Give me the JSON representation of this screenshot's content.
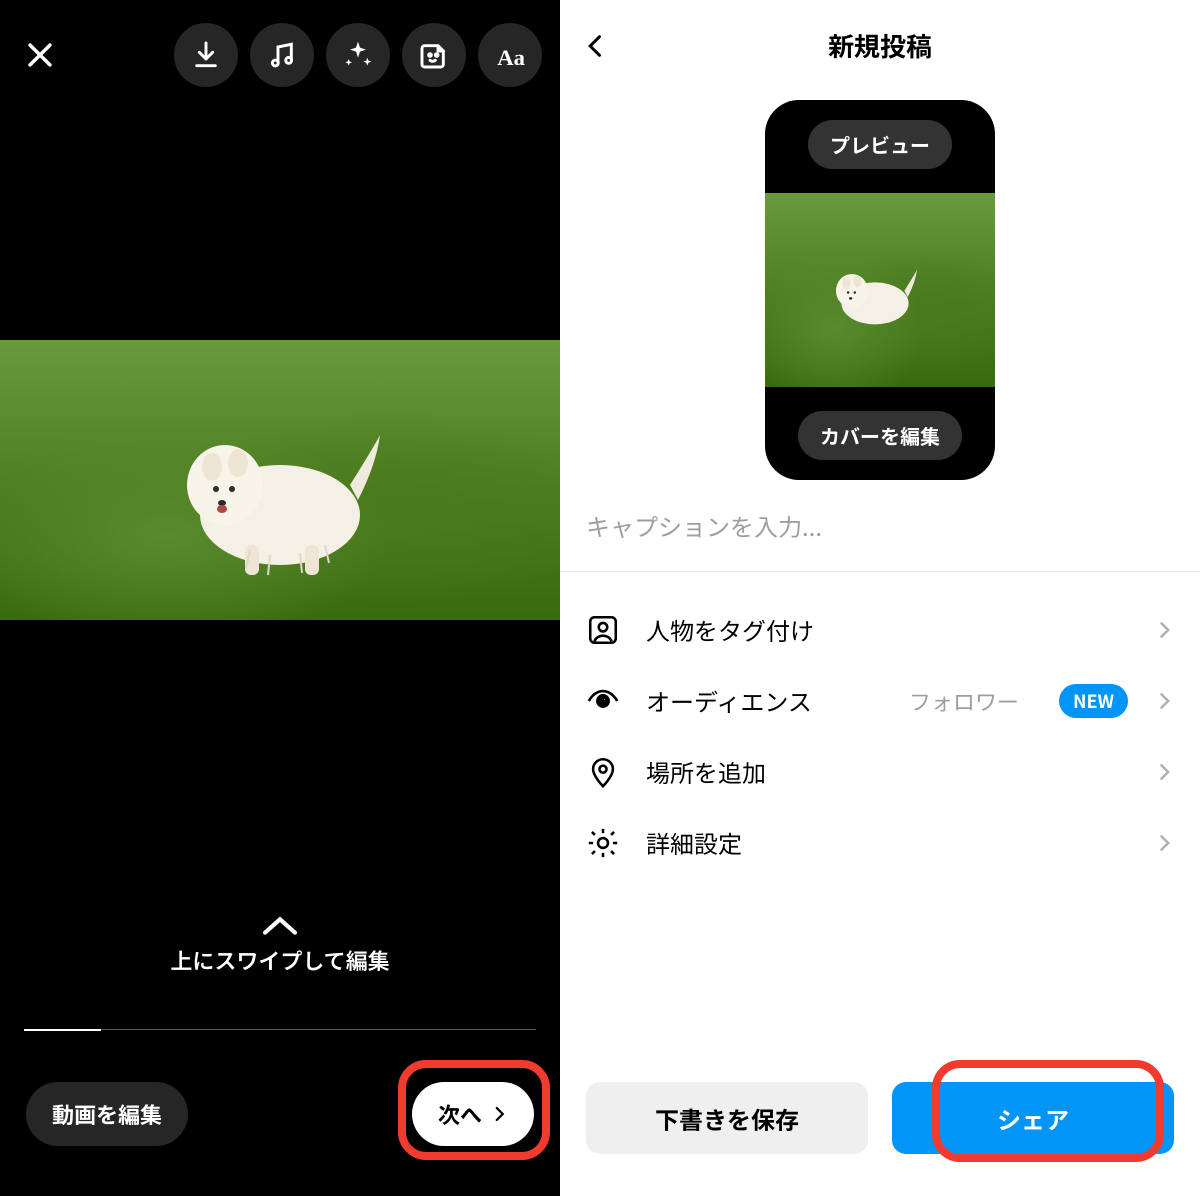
{
  "left": {
    "swipe_hint": "上にスワイプして編集",
    "edit_video_label": "動画を編集",
    "next_label": "次へ"
  },
  "right": {
    "title": "新規投稿",
    "preview_label": "プレビュー",
    "edit_cover_label": "カバーを編集",
    "caption_placeholder": "キャプションを入力...",
    "menu": {
      "tag_people": "人物をタグ付け",
      "audience": "オーディエンス",
      "audience_value": "フォロワー",
      "audience_badge": "NEW",
      "add_location": "場所を追加",
      "advanced": "詳細設定"
    },
    "save_draft_label": "下書きを保存",
    "share_label": "シェア"
  }
}
